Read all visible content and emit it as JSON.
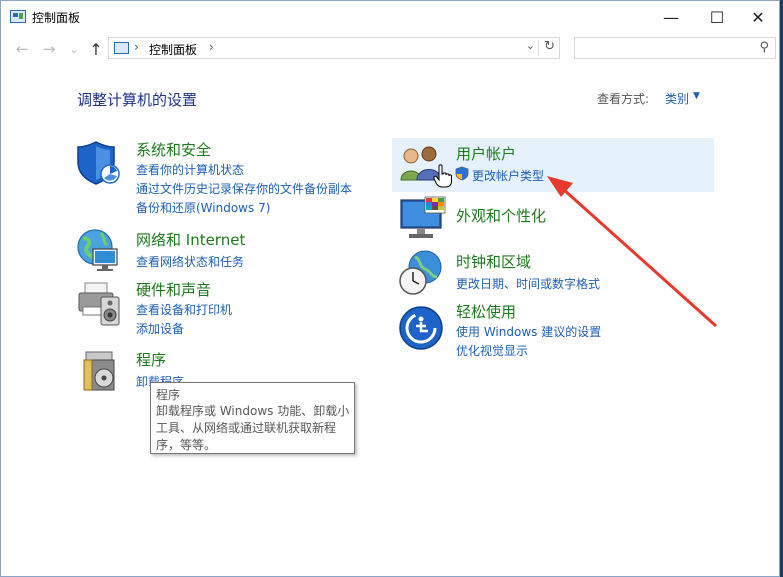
{
  "window": {
    "title": "控制面板",
    "minimize_glyph": "—",
    "maximize_glyph": "☐",
    "close_glyph": "✕"
  },
  "nav": {
    "back_glyph": "←",
    "forward_glyph": "→",
    "recent_glyph": "⌄",
    "up_glyph": "↑"
  },
  "address": {
    "separator": "›",
    "path": "控制面板",
    "dropdown_glyph": "⌄",
    "refresh_glyph": "↻"
  },
  "search": {
    "placeholder": "",
    "icon_glyph": "⚲"
  },
  "content": {
    "heading": "调整计算机的设置",
    "view_by_label": "查看方式:",
    "view_by_value": "类别",
    "view_by_caret": "▼"
  },
  "categories": {
    "system_security": {
      "title": "系统和安全",
      "links": [
        "查看你的计算机状态",
        "通过文件历史记录保存你的文件备份副本",
        "备份和还原(Windows 7)"
      ]
    },
    "network": {
      "title": "网络和 Internet",
      "links": [
        "查看网络状态和任务"
      ]
    },
    "hardware": {
      "title": "硬件和声音",
      "links": [
        "查看设备和打印机",
        "添加设备"
      ]
    },
    "programs": {
      "title": "程序",
      "links": [
        "卸载程序"
      ]
    },
    "user_accounts": {
      "title": "用户帐户",
      "links": [
        "更改帐户类型"
      ]
    },
    "appearance": {
      "title": "外观和个性化",
      "links": []
    },
    "clock_region": {
      "title": "时钟和区域",
      "links": [
        "更改日期、时间或数字格式"
      ]
    },
    "ease_of_access": {
      "title": "轻松使用",
      "links": [
        "使用 Windows 建议的设置",
        "优化视觉显示"
      ]
    }
  },
  "tooltip": {
    "title": "程序",
    "body": "卸载程序或 Windows 功能、卸载小工具、从网络或通过联机获取新程序，等等。"
  },
  "colors": {
    "category_title": "#1e7a1e",
    "link": "#1e5fb4",
    "heading": "#1e3287",
    "highlight": "#e5f1fb",
    "annotation_arrow": "#e8392d"
  }
}
